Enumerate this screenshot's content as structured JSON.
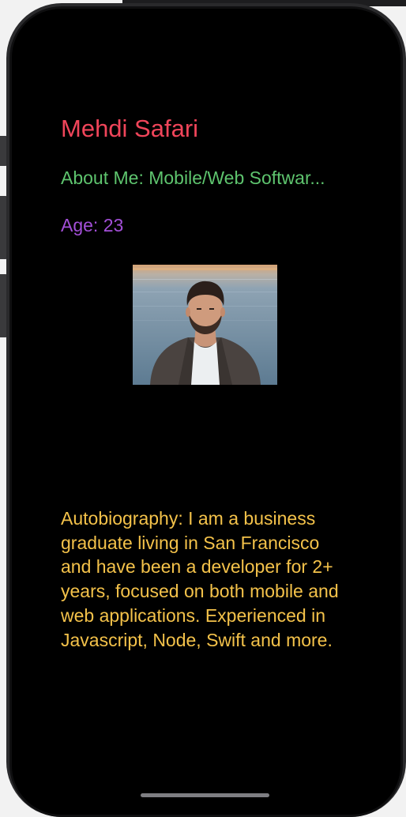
{
  "profile": {
    "name": "Mehdi Safari",
    "about": "About Me: Mobile/Web Softwar...",
    "age": "Age: 23",
    "photo_icon": "profile-photo",
    "autobiography": "Autobiography: I am a business graduate living in San Francisco and have been a developer for 2+ years, focused on both mobile and web applications. Experienced in Javascript, Node, Swift and more."
  },
  "colors": {
    "background": "#000000",
    "name": "#f0455a",
    "about": "#5ec46e",
    "age": "#a34fd8",
    "autobiography": "#f4c24a"
  }
}
